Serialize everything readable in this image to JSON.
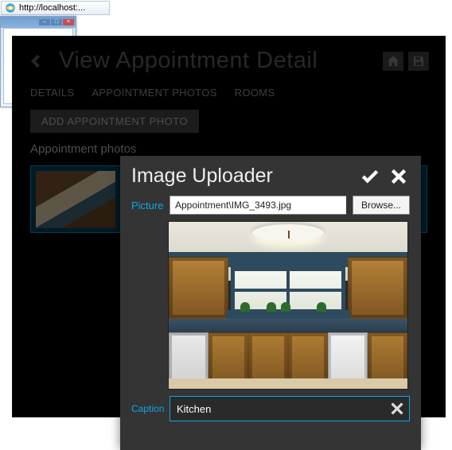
{
  "ie_tab": {
    "url_text": "http://localhost:..."
  },
  "app": {
    "header": {
      "title": "View Appointment Detail",
      "icons": {
        "home": "home-icon",
        "save": "save-icon"
      }
    },
    "tabs": [
      "DETAILS",
      "APPOINTMENT PHOTOS",
      "ROOMS"
    ],
    "add_button": "ADD APPOINTMENT PHOTO",
    "section_label": "Appointment photos",
    "thumb_alt": "kitchen-thumbnail"
  },
  "modal": {
    "title": "Image Uploader",
    "confirm_icon": "check-icon",
    "cancel_icon": "close-icon",
    "picture_label": "Picture",
    "file_path": "Appointment\\IMG_3493.jpg",
    "browse_label": "Browse...",
    "caption_label": "Caption",
    "caption_value": "Kitchen",
    "clear_icon": "clear-icon"
  }
}
